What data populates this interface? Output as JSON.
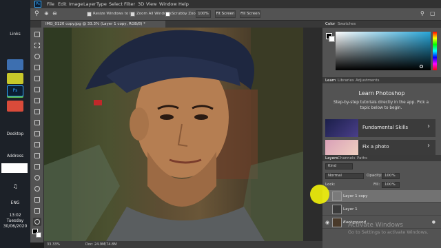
{
  "taskbar": {
    "links_label": "Links",
    "desktop_label": "Desktop",
    "address_label": "Address",
    "language": "ENG",
    "time": "13:02",
    "day": "Tuesday",
    "date": "30/06/2020"
  },
  "menubar": {
    "items": [
      "File",
      "Edit",
      "Image",
      "Layer",
      "Type",
      "Select",
      "Filter",
      "3D",
      "View",
      "Window",
      "Help"
    ]
  },
  "options": {
    "resize_windows": "Resize Windows to Fit",
    "zoom_all": "Zoom All Windows",
    "scrubby_zoom": "Scrubby Zoom",
    "zoom_pct": "100%",
    "fit_screen": "Fit Screen",
    "fill_screen": "Fill Screen"
  },
  "document": {
    "tab_title": "IMG_0120 copy.jpg @ 33.3% (Layer 1 copy, RGB/8) *",
    "zoom": "33.33%",
    "doc_info": "Doc: 24.9M/74.8M"
  },
  "color_panel": {
    "tabs": [
      "Color",
      "Swatches"
    ],
    "picker_base": "#27a6d9"
  },
  "learn_panel": {
    "tabs": [
      "Learn",
      "Libraries",
      "Adjustments"
    ],
    "title": "Learn Photoshop",
    "description": "Step-by-step tutorials directly in the app. Pick a topic below to begin.",
    "cards": [
      {
        "label": "Fundamental Skills"
      },
      {
        "label": "Fix a photo"
      }
    ]
  },
  "layers_panel": {
    "tabs": [
      "Layers",
      "Channels",
      "Paths"
    ],
    "kind_filter": "Kind",
    "blend_mode": "Normal",
    "opacity_label": "Opacity:",
    "opacity_value": "100%",
    "lock_label": "Lock:",
    "fill_label": "Fill:",
    "fill_value": "100%",
    "layers": [
      {
        "name": "Layer 1 copy",
        "selected": true,
        "visible": false
      },
      {
        "name": "Layer 1",
        "selected": false,
        "visible": false
      },
      {
        "name": "Background",
        "selected": false,
        "visible": true
      }
    ]
  },
  "watermark": {
    "line1": "Activate Windows",
    "line2": "Go to Settings to activate Windows."
  }
}
